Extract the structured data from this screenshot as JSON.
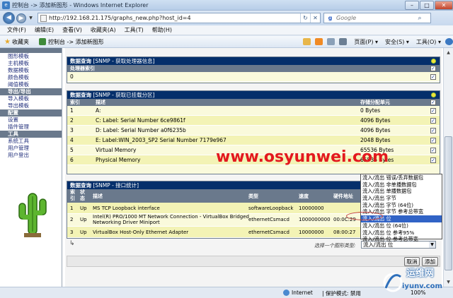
{
  "window": {
    "title": "控制台 -> 添加新图形 - Windows Internet Explorer",
    "min_label": "–",
    "max_label": "□",
    "close_label": "✕"
  },
  "address": {
    "url": "http://192.168.21.175/graphs_new.php?host_id=4",
    "go_icon": "↻",
    "stop_icon": "✕"
  },
  "search": {
    "placeholder": "Google"
  },
  "menu": [
    "文件(F)",
    "编辑(E)",
    "查看(V)",
    "收藏夹(A)",
    "工具(T)",
    "帮助(H)"
  ],
  "favorites": {
    "label": "收藏夹",
    "tab_title": "控制台 -> 添加新图形"
  },
  "commands": [
    "页面(P) ▾",
    "安全(S) ▾",
    "工具(O) ▾"
  ],
  "sidebar": {
    "items": [
      {
        "type": "item",
        "label": "图形模板"
      },
      {
        "type": "item",
        "label": "主机模板"
      },
      {
        "type": "item",
        "label": "数据模板"
      },
      {
        "type": "item",
        "label": "颜色模板"
      },
      {
        "type": "item",
        "label": "阈值模板"
      },
      {
        "type": "head",
        "label": "导出/导出"
      },
      {
        "type": "item",
        "label": "导入模板"
      },
      {
        "type": "item",
        "label": "导出模板"
      },
      {
        "type": "head",
        "label": "配置"
      },
      {
        "type": "item",
        "label": "设置"
      },
      {
        "type": "item",
        "label": "插件管理"
      },
      {
        "type": "head",
        "label": "工具"
      },
      {
        "type": "item",
        "label": "系统工具"
      },
      {
        "type": "item",
        "label": "用户管理"
      },
      {
        "type": "item",
        "label": "用户登出"
      }
    ]
  },
  "cpu_box": {
    "title": "数据查询",
    "subtitle": "[SNMP - 获取处理器信息]",
    "col_index": "处理器索引",
    "rows": [
      {
        "index": "0"
      }
    ]
  },
  "part_box": {
    "title": "数据查询",
    "subtitle": "[SNMP - 获取已挂载分区]",
    "columns": {
      "index": "索引",
      "desc": "描述",
      "alloc": "存储分配单元"
    },
    "rows": [
      {
        "index": "1",
        "desc": "A:",
        "alloc": "0 Bytes"
      },
      {
        "index": "2",
        "desc": "C: Label: Serial Number 6ce9861f",
        "alloc": "4096 Bytes"
      },
      {
        "index": "3",
        "desc": "D: Label: Serial Number a0f6235b",
        "alloc": "4096 Bytes"
      },
      {
        "index": "4",
        "desc": "E: Label:WIN_2003_SP2 Serial Number 7179e967",
        "alloc": "2048 Bytes"
      },
      {
        "index": "5",
        "desc": "Virtual Memory",
        "alloc": "65536 Bytes"
      },
      {
        "index": "6",
        "desc": "Physical Memory",
        "alloc": "65536 Bytes"
      }
    ]
  },
  "if_box": {
    "title": "数据查询",
    "subtitle": "[SNMP - 接口统计]",
    "columns": {
      "index": "索引",
      "status": "状态",
      "desc": "描述",
      "type": "类型",
      "speed": "速度",
      "hw": "硬件地址"
    },
    "rows": [
      {
        "index": "1",
        "status": "Up",
        "desc": "MS TCP Loopback interface",
        "type": "softwareLoopback",
        "speed": "10000000",
        "hw": ""
      },
      {
        "index": "2",
        "status": "Up",
        "desc": "Intel(R) PRO/1000 MT Network Connection - VirtualBox Bridged Networking Driver Miniport",
        "type": "ethernetCsmacd",
        "speed": "1000000000",
        "hw": "00:0C:29"
      },
      {
        "index": "3",
        "status": "Up",
        "desc": "VirtualBox Host-Only Ethernet Adapter",
        "type": "ethernetCsmacd",
        "speed": "10000000",
        "hw": "08:00:27"
      }
    ]
  },
  "footer": {
    "arrow": "↳",
    "select_label": "选择一个图形类型:",
    "select_value": "流入/流出 位"
  },
  "dropdown": {
    "options": [
      "流入/流出 错误/丢弃数据包",
      "流入/流出 非单播数据包",
      "流入/流出 单播数据包",
      "流入/流出 字节",
      "流入/流出 字节 (64位)",
      "流入/流出 字节 参考总带宽",
      "流入/流出 位",
      "流入/流出 位 (64位)",
      "流入/流出 位 参考95%",
      "流入/流出 位 参考总带宽"
    ],
    "selected_index": 6
  },
  "buttons": {
    "cancel": "取消",
    "create": "添加"
  },
  "statusbar": {
    "zone": "Internet",
    "mode": "| 保护模式: 禁用",
    "zoom": "100%"
  },
  "watermarks": {
    "site": "www.osyunwei.com",
    "logo_top": "运维网",
    "logo_bottom": "iyunv.com"
  }
}
